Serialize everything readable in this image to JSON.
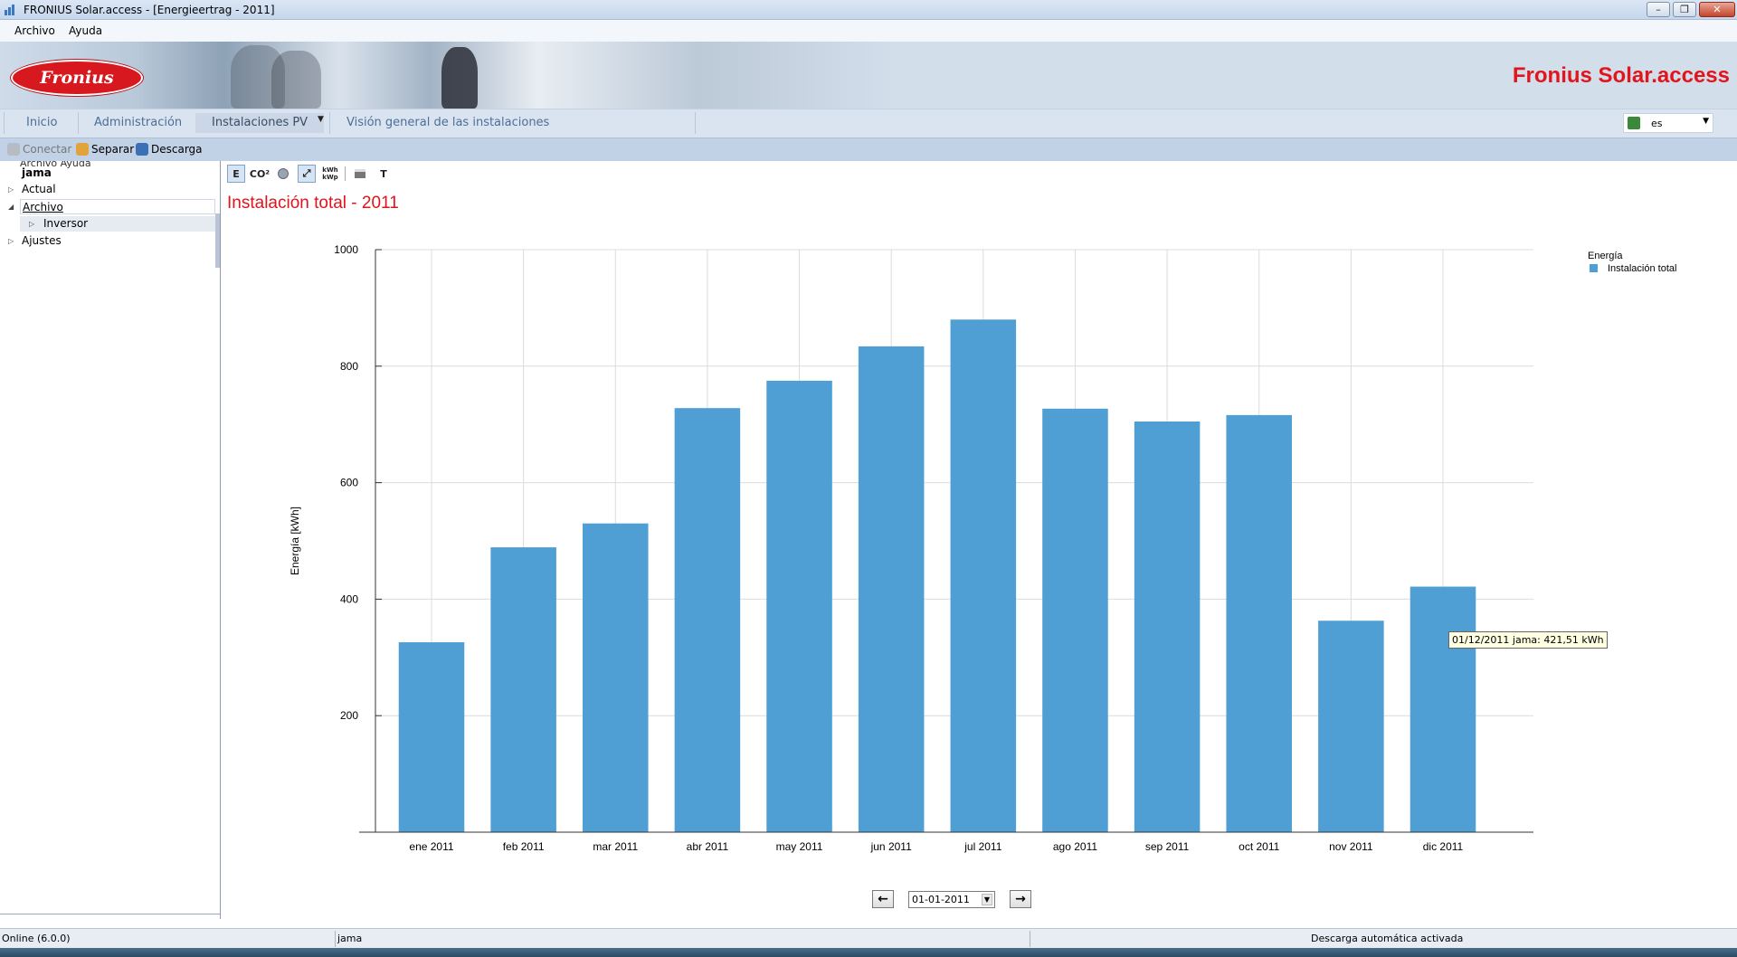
{
  "window": {
    "title": "FRONIUS Solar.access - [Energieertrag - 2011]"
  },
  "menubar": {
    "items": [
      "Archivo",
      "Ayuda"
    ]
  },
  "banner": {
    "logo_text": "Fronius",
    "brand": "Fronius Solar.access"
  },
  "tabs": {
    "items": [
      "Inicio",
      "Administración",
      "Instalaciones PV",
      "Visión general de las instalaciones"
    ],
    "active": "Instalaciones PV"
  },
  "language": {
    "value": "es"
  },
  "toolbar": {
    "connect": "Conectar",
    "separate": "Separar",
    "download": "Descarga"
  },
  "tree": {
    "ghost": "Archivo    Ayuda",
    "root": "jama",
    "items": [
      "Actual",
      "Archivo",
      "Inversor",
      "Ajustes"
    ]
  },
  "charttools": {
    "energy": "E",
    "co2": "CO²",
    "text": "T"
  },
  "chart": {
    "title": "Instalación total - 2011",
    "tooltip": "01/12/2011 jama: 421,51 kWh",
    "date_value": "01-01-2011"
  },
  "chart_data": {
    "type": "bar",
    "title": "Instalación total - 2011",
    "xlabel": "",
    "ylabel": "Energía [kWh]",
    "ylim": [
      0,
      1000
    ],
    "yticks": [
      200,
      400,
      600,
      800,
      1000
    ],
    "grid": true,
    "legend": {
      "title": "Energía",
      "placement": "top-right"
    },
    "categories": [
      "ene 2011",
      "feb 2011",
      "mar 2011",
      "abr 2011",
      "may 2011",
      "jun 2011",
      "jul 2011",
      "ago 2011",
      "sep 2011",
      "oct 2011",
      "nov 2011",
      "dic 2011"
    ],
    "series": [
      {
        "name": "Instalación total",
        "color": "#4f9fd5",
        "values": [
          326,
          489,
          530,
          728,
          775,
          834,
          880,
          727,
          705,
          716,
          363,
          421.51
        ]
      }
    ]
  },
  "statusbar": {
    "left": "Online (6.0.0)",
    "middle": "jama",
    "right": "Descarga automática activada"
  }
}
